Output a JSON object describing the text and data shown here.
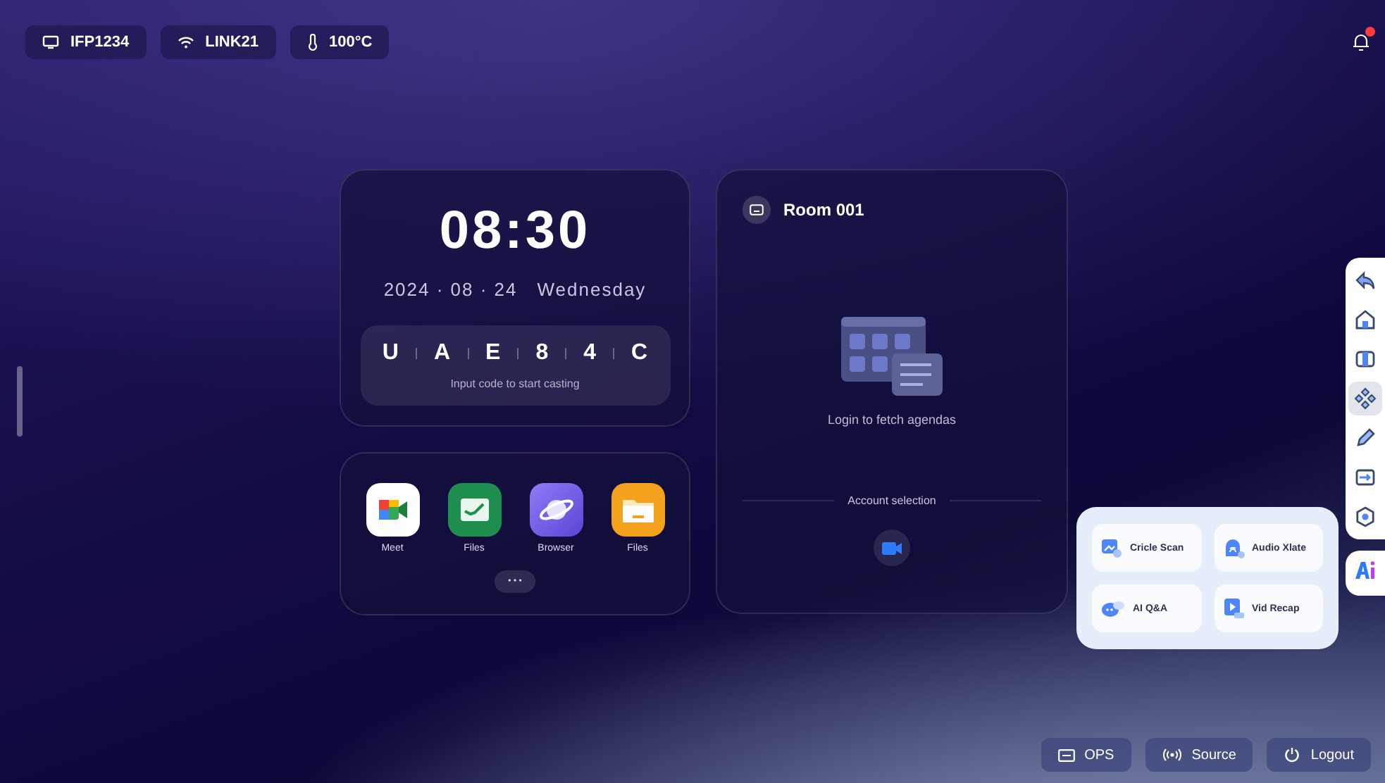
{
  "status_chips": [
    {
      "kind": "display",
      "label": "IFP1234"
    },
    {
      "kind": "wifi",
      "label": "LINK21"
    },
    {
      "kind": "temperature",
      "label": "100°C"
    }
  ],
  "notifications": {
    "unread": true
  },
  "clock": {
    "time": "08:30",
    "date": "2024 · 08 · 24",
    "weekday": "Wednesday",
    "cast_code": [
      "U",
      "A",
      "E",
      "8",
      "4",
      "C"
    ],
    "cast_hint": "Input code to start casting"
  },
  "apps": [
    {
      "kind": "meet",
      "label": "Meet"
    },
    {
      "kind": "files-green",
      "label": "Files"
    },
    {
      "kind": "browser",
      "label": "Browser"
    },
    {
      "kind": "files-folder",
      "label": "Files"
    }
  ],
  "more_button": "• • •",
  "room": {
    "name": "Room 001",
    "empty_message": "Login to fetch agendas",
    "account_label": "Account selection"
  },
  "toolbar": [
    {
      "kind": "back",
      "selected": false
    },
    {
      "kind": "home",
      "selected": false
    },
    {
      "kind": "windows",
      "selected": false
    },
    {
      "kind": "navigate",
      "selected": true
    },
    {
      "kind": "pen",
      "selected": false
    },
    {
      "kind": "input",
      "selected": false
    },
    {
      "kind": "settings",
      "selected": false
    }
  ],
  "ai_tools": [
    {
      "kind": "scan",
      "label": "Cricle Scan"
    },
    {
      "kind": "audio",
      "label": "Audio Xlate"
    },
    {
      "kind": "chat",
      "label": "AI Q&A"
    },
    {
      "kind": "video",
      "label": "Vid Recap"
    }
  ],
  "bottom_buttons": [
    {
      "kind": "ops",
      "label": "OPS"
    },
    {
      "kind": "source",
      "label": "Source"
    },
    {
      "kind": "power",
      "label": "Logout"
    }
  ]
}
